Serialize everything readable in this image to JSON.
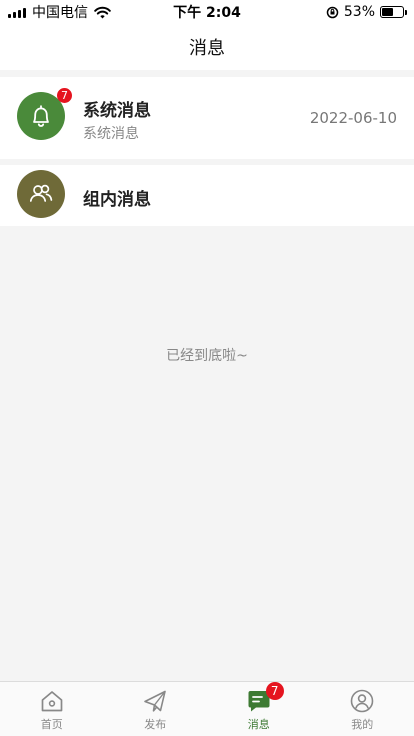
{
  "status_bar": {
    "carrier": "中国电信",
    "time": "下午 2:04",
    "battery_text": "53%",
    "battery_level": 0.53
  },
  "header": {
    "title": "消息"
  },
  "messages": [
    {
      "title": "系统消息",
      "subtitle": "系统消息",
      "date": "2022-06-10",
      "badge": "7",
      "icon": "bell-icon",
      "color": "#4a8a3a"
    },
    {
      "title": "组内消息",
      "icon": "group-icon",
      "color": "#6f6a38"
    }
  ],
  "list_end_text": "已经到底啦~",
  "tabs": [
    {
      "label": "首页",
      "icon": "home-icon"
    },
    {
      "label": "发布",
      "icon": "paper-plane-icon"
    },
    {
      "label": "消息",
      "icon": "message-icon",
      "badge": "7",
      "active": true
    },
    {
      "label": "我的",
      "icon": "user-icon"
    }
  ],
  "colors": {
    "accent": "#3d7a33",
    "badge": "#e5141f"
  }
}
